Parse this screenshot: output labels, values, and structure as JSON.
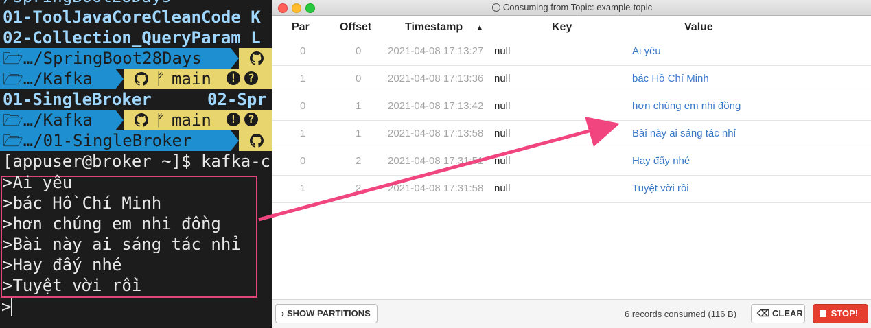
{
  "terminal": {
    "top_text": "/SpringBoot28Days",
    "lines": [
      {
        "text": "01-ToolJavaCoreCleanCode K"
      },
      {
        "text": "02-Collection_QueryParam L"
      }
    ],
    "dir1": "…/SpringBoot28Days",
    "dir2": "…/Kafka",
    "branch": "main",
    "broker_row_left": "01-SingleBroker",
    "broker_row_right": "02-Spr",
    "dir3": "…/Kafka",
    "dir4": "…/01-SingleBroker",
    "prompt": "[appuser@broker ~]$ kafka-c",
    "prompt_char": ">",
    "messages": [
      ">Ai yêu",
      ">bác Hồ Chí Minh",
      ">hơn chúng em nhi đồng",
      ">Bài này ai sáng tác nhỉ",
      ">Hay đấy nhé",
      ">Tuyệt vời rồi"
    ]
  },
  "window": {
    "title": "Consuming from Topic: example-topic",
    "columns": {
      "par": "Par",
      "offset": "Offset",
      "timestamp": "Timestamp",
      "key": "Key",
      "value": "Value"
    },
    "rows": [
      {
        "par": "0",
        "offset": "0",
        "timestamp": "2021-04-08 17:13:27",
        "key": "null",
        "value": "Ai yêu"
      },
      {
        "par": "1",
        "offset": "0",
        "timestamp": "2021-04-08 17:13:36",
        "key": "null",
        "value": "bác Hồ Chí Minh"
      },
      {
        "par": "0",
        "offset": "1",
        "timestamp": "2021-04-08 17:13:42",
        "key": "null",
        "value": "hơn chúng em nhi đồng"
      },
      {
        "par": "1",
        "offset": "1",
        "timestamp": "2021-04-08 17:13:58",
        "key": "null",
        "value": "Bài này ai sáng  tác nhỉ"
      },
      {
        "par": "0",
        "offset": "2",
        "timestamp": "2021-04-08 17:31:51",
        "key": "null",
        "value": "Hay đấy nhé"
      },
      {
        "par": "1",
        "offset": "2",
        "timestamp": "2021-04-08 17:31:58",
        "key": "null",
        "value": "Tuyệt vời rồi"
      }
    ],
    "show_partitions_label": "SHOW PARTITIONS",
    "records_info": "6 records consumed (116 B)",
    "clear_label": "CLEAR",
    "stop_label": "STOP!"
  },
  "colors": {
    "accent_blue": "#3978c7",
    "stop_red": "#e53e2e",
    "arrow_pink": "#f0457f",
    "terminal_bg": "#1c1c1c"
  }
}
